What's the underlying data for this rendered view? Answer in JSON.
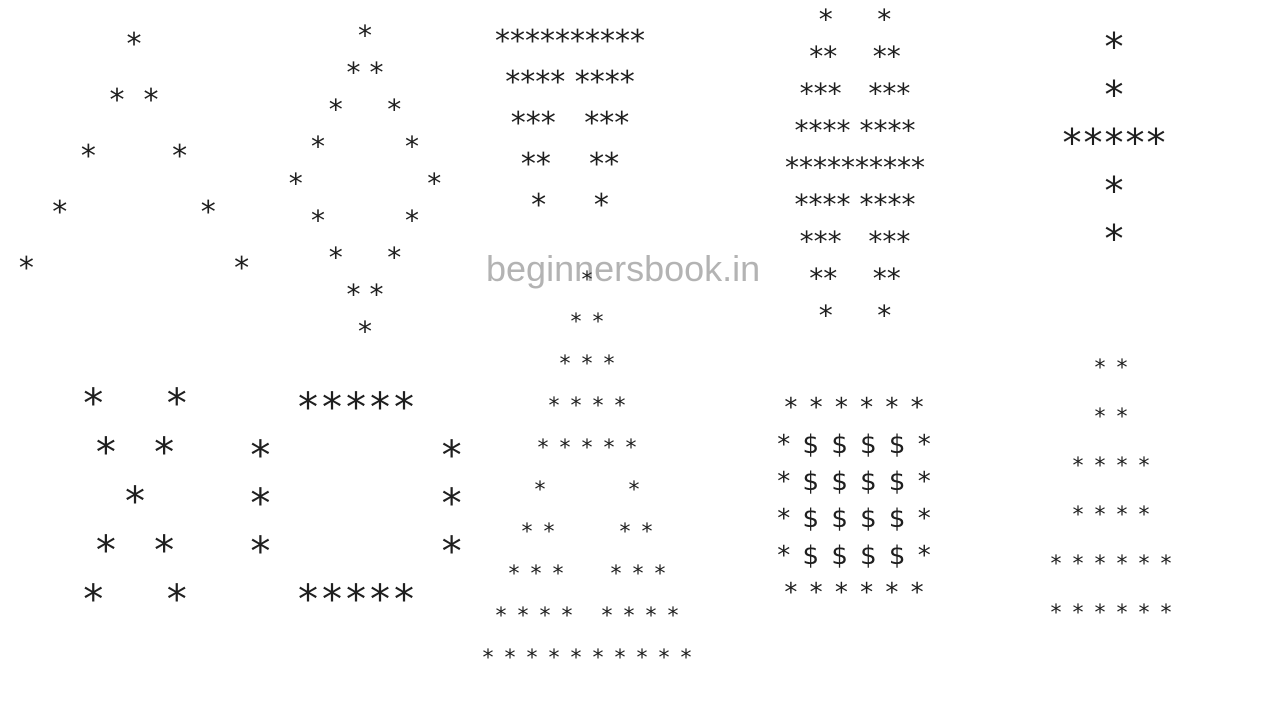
{
  "watermark": "beginnersbook.in",
  "patterns": [
    {
      "name": "pattern-hollow-pyramid",
      "rows": [
        "*",
        "*  *",
        "*        *",
        "*              *",
        "*                     *"
      ]
    },
    {
      "name": "pattern-hollow-diamond",
      "rows": [
        "*",
        "* *",
        "*     *",
        "*         *",
        "*              *",
        "*         *",
        "*     *",
        "* *",
        "*"
      ]
    },
    {
      "name": "pattern-inverted-hollow-pyramid",
      "rows": [
        "**********",
        "**** ****",
        "***   ***",
        "**    **",
        "*     *"
      ]
    },
    {
      "name": "pattern-diamond-split",
      "rows": [
        "*     *",
        "**    **",
        "***   ***",
        "**** ****",
        "**********",
        "**** ****",
        "***   ***",
        "**    **",
        "*     *"
      ]
    },
    {
      "name": "pattern-plus",
      "rows": [
        "*",
        "*",
        "*****",
        "*",
        "*"
      ]
    },
    {
      "name": "pattern-x",
      "rows": [
        "*     *",
        "*   *",
        "*",
        "*   *",
        "*     *"
      ]
    },
    {
      "name": "pattern-hollow-square",
      "rows": [
        "*****",
        "*          *",
        "*          *",
        "*          *",
        "*****"
      ]
    },
    {
      "name": "pattern-pyramid-hourglass",
      "rows": [
        "*",
        "* *",
        "* * *",
        "* * * *",
        "* * * * *",
        "*         *",
        "* *       * *",
        "* * *     * * *",
        "* * * *   * * * *",
        "* * * * * * * * * *"
      ]
    },
    {
      "name": "pattern-dollar-square",
      "rows": [
        "* * * * * *",
        "* $ $ $ $ *",
        "* $ $ $ $ *",
        "* $ $ $ $ *",
        "* $ $ $ $ *",
        "* * * * * *"
      ]
    },
    {
      "name": "pattern-pairs",
      "rows": [
        "* *",
        "* *",
        "* * * *",
        "* * * *",
        "* * * * * *",
        "* * * * * *"
      ]
    }
  ]
}
